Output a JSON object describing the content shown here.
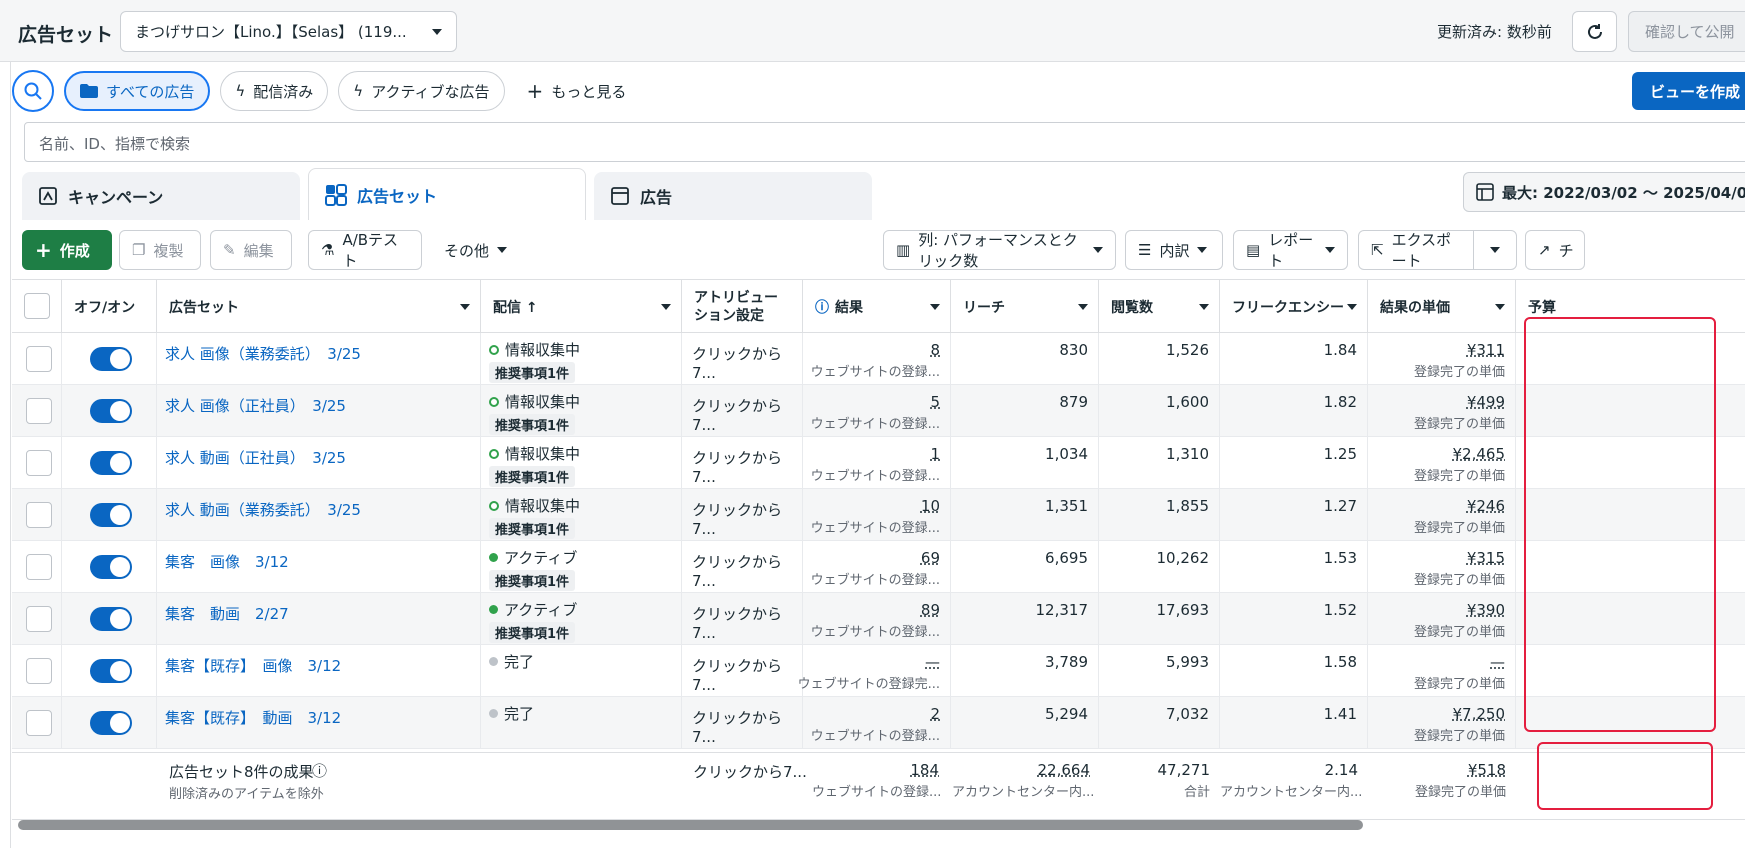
{
  "header": {
    "title": "広告セット",
    "account": "まつげサロン【Lino.】【Selas】 (119...",
    "updated": "更新済み: 数秒前",
    "publish": "確認して公開"
  },
  "filters": {
    "all_ads": "すべての広告",
    "delivered": "配信済み",
    "active_ads": "アクティブな広告",
    "more": "もっと見る",
    "create_view": "ビューを作成"
  },
  "search": {
    "placeholder": "名前、ID、指標で検索"
  },
  "tabs": {
    "campaign": "キャンペーン",
    "adset": "広告セット",
    "ad": "広告"
  },
  "daterange": "最大: 2022/03/02 〜 2025/04/0",
  "toolbar": {
    "create": "作成",
    "duplicate": "複製",
    "edit": "編集",
    "abtest": "A/Bテスト",
    "other": "その他",
    "columns": "列: パフォーマンスとクリック数",
    "breakdown": "内訳",
    "report": "レポート",
    "export": "エクスポート",
    "chart": "チ"
  },
  "columns": {
    "toggle": "オフ/オン",
    "adset": "広告セット",
    "delivery": "配信 ↑",
    "attribution": "アトリビューション設定",
    "result": "結果",
    "reach": "リーチ",
    "impressions": "閲覧数",
    "frequency": "フリークエンシー",
    "cpr": "結果の単価",
    "budget": "予算"
  },
  "rows": [
    {
      "name": "求人 画像（業務委託）　3/25",
      "status": "情報収集中",
      "rec": "推奨事項1件",
      "attr": "クリックから7...",
      "result": "8",
      "result_sub": "ウェブサイトの登録...",
      "reach": "830",
      "impr": "1,526",
      "freq": "1.84",
      "cpr": "¥311",
      "cpr_sub": "登録完了の単価"
    },
    {
      "name": "求人 画像（正社員）　3/25",
      "status": "情報収集中",
      "rec": "推奨事項1件",
      "attr": "クリックから7...",
      "result": "5",
      "result_sub": "ウェブサイトの登録...",
      "reach": "879",
      "impr": "1,600",
      "freq": "1.82",
      "cpr": "¥499",
      "cpr_sub": "登録完了の単価"
    },
    {
      "name": "求人 動画（正社員）　3/25",
      "status": "情報収集中",
      "rec": "推奨事項1件",
      "attr": "クリックから7...",
      "result": "1",
      "result_sub": "ウェブサイトの登録...",
      "reach": "1,034",
      "impr": "1,310",
      "freq": "1.25",
      "cpr": "¥2,465",
      "cpr_sub": "登録完了の単価"
    },
    {
      "name": "求人 動画（業務委託）　3/25",
      "status": "情報収集中",
      "rec": "推奨事項1件",
      "attr": "クリックから7...",
      "result": "10",
      "result_sub": "ウェブサイトの登録...",
      "reach": "1,351",
      "impr": "1,855",
      "freq": "1.27",
      "cpr": "¥246",
      "cpr_sub": "登録完了の単価"
    },
    {
      "name": "集客　画像　3/12",
      "status": "アクティブ",
      "rec": "推奨事項1件",
      "attr": "クリックから7...",
      "result": "69",
      "result_sub": "ウェブサイトの登録...",
      "reach": "6,695",
      "impr": "10,262",
      "freq": "1.53",
      "cpr": "¥315",
      "cpr_sub": "登録完了の単価"
    },
    {
      "name": "集客　動画　2/27",
      "status": "アクティブ",
      "rec": "推奨事項1件",
      "attr": "クリックから7...",
      "result": "89",
      "result_sub": "ウェブサイトの登録...",
      "reach": "12,317",
      "impr": "17,693",
      "freq": "1.52",
      "cpr": "¥390",
      "cpr_sub": "登録完了の単価"
    },
    {
      "name": "集客【既存】　画像　3/12",
      "status": "完了",
      "rec": "",
      "attr": "クリックから7...",
      "result": "—",
      "result_sub": "ウェブサイトの登録完...",
      "reach": "3,789",
      "impr": "5,993",
      "freq": "1.58",
      "cpr": "—",
      "cpr_sub": "登録完了の単価"
    },
    {
      "name": "集客【既存】　動画　3/12",
      "status": "完了",
      "rec": "",
      "attr": "クリックから7...",
      "result": "2",
      "result_sub": "ウェブサイトの登録...",
      "reach": "5,294",
      "impr": "7,032",
      "freq": "1.41",
      "cpr": "¥7,250",
      "cpr_sub": "登録完了の単価"
    }
  ],
  "summary": {
    "title": "広告セット8件の成果",
    "sub": "削除済みのアイテムを除外",
    "attr": "クリックから7...",
    "result": "184",
    "result_sub": "ウェブサイトの登録...",
    "reach": "22,664",
    "reach_sub": "アカウントセンター内...",
    "impr": "47,271",
    "impr_sub": "合計",
    "freq": "2.14",
    "freq_sub": "アカウントセンター内...",
    "cpr": "¥518",
    "cpr_sub": "登録完了の単価"
  },
  "colors": {
    "brand": "#0a66c2",
    "green": "#1e7e45",
    "highlight": "#e41e3f"
  }
}
